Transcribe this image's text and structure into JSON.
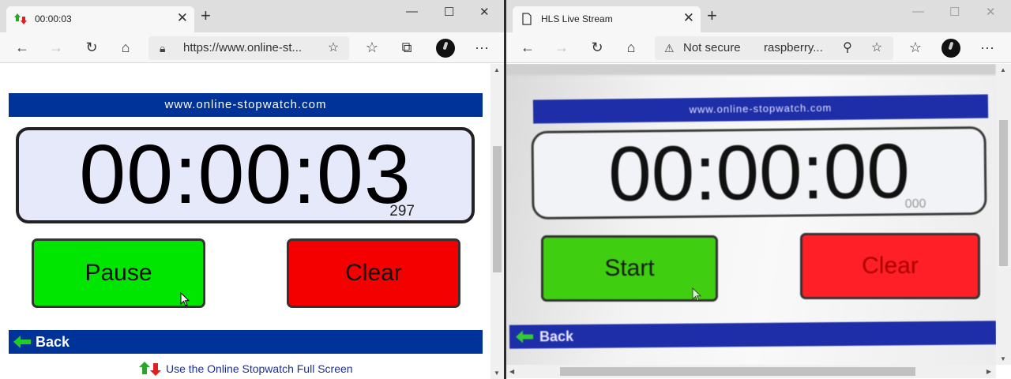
{
  "left": {
    "tab_title": "00:00:03",
    "url": "https://www.online-st...",
    "banner": "www.online-stopwatch.com",
    "time": "00:00:03",
    "ms": "297",
    "pause_label": "Pause",
    "clear_label": "Clear",
    "back_label": "Back",
    "fullscreen_link": "Use the Online Stopwatch Full Screen"
  },
  "right": {
    "tab_title": "HLS Live Stream",
    "security": "Not secure",
    "url": "raspberry...",
    "banner": "www.online-stopwatch.com",
    "time": "00:00:00",
    "ms": "000",
    "start_label": "Start",
    "clear_label": "Clear",
    "back_label": "Back"
  },
  "colors": {
    "banner_blue": "#003399",
    "green_button": "#00e600",
    "red_button": "#f40000",
    "clock_bg": "#e6e9fa"
  },
  "icons": {
    "tab_favicon_left": "stopwatch-arrows-icon",
    "tab_favicon_right": "page-icon",
    "back": "back-arrow-icon",
    "forward": "forward-arrow-icon",
    "refresh": "refresh-icon",
    "home": "home-icon",
    "lock": "lock-icon",
    "warning": "warning-icon",
    "zoom": "zoom-icon",
    "favorite": "star-icon",
    "favorites_list": "favorites-icon",
    "collections": "collections-icon",
    "profile": "avatar",
    "menu": "more-icon"
  }
}
